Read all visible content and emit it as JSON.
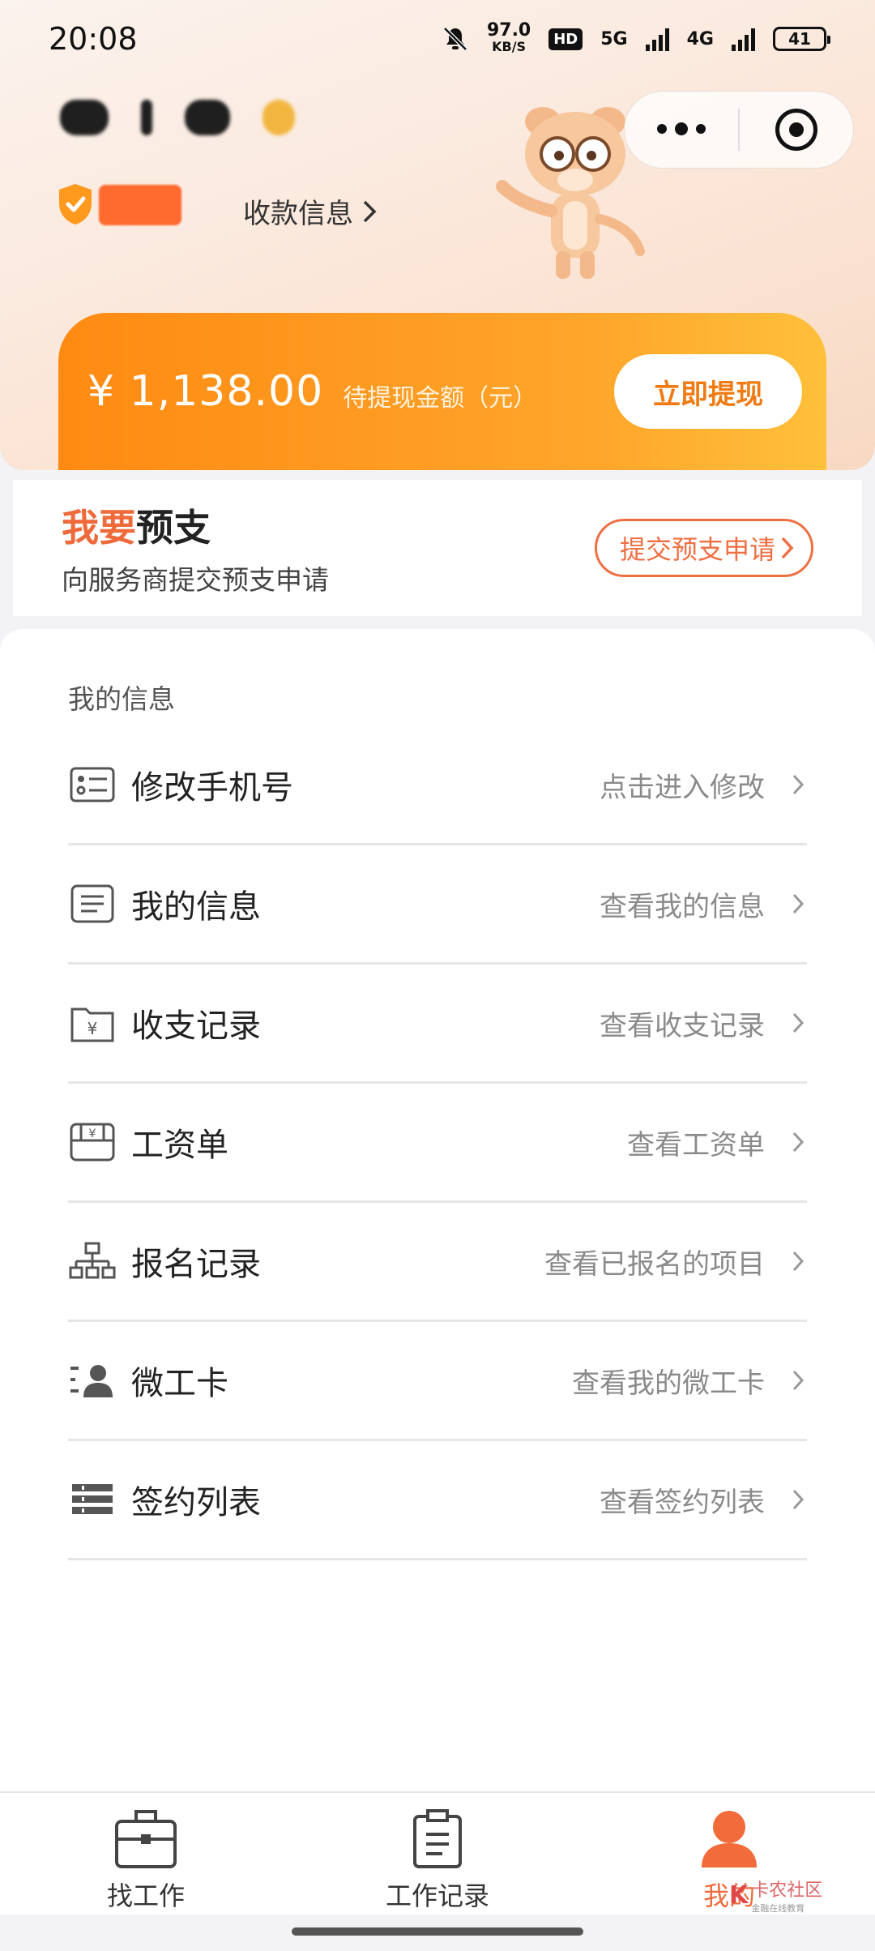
{
  "status_bar": {
    "time": "20:08",
    "net_speed": "97.0",
    "net_unit": "KB/S",
    "hd_label": "HD",
    "net1": "5G",
    "net2": "4G",
    "battery": "41"
  },
  "header": {
    "pay_info_label": "收款信息"
  },
  "balance": {
    "amount": "¥ 1,138.00",
    "label": "待提现金额（元）",
    "withdraw_button": "立即提现"
  },
  "advance": {
    "title_accent": "我要",
    "title_rest": "预支",
    "subtitle": "向服务商提交预支申请",
    "button": "提交预支申请"
  },
  "info": {
    "section_title": "我的信息",
    "items": [
      {
        "label": "修改手机号",
        "hint": "点击进入修改",
        "icon": "id-card-icon"
      },
      {
        "label": "我的信息",
        "hint": "查看我的信息",
        "icon": "document-icon"
      },
      {
        "label": "收支记录",
        "hint": "查看收支记录",
        "icon": "yuan-folder-icon"
      },
      {
        "label": "工资单",
        "hint": "查看工资单",
        "icon": "payslip-icon"
      },
      {
        "label": "报名记录",
        "hint": "查看已报名的项目",
        "icon": "org-chart-icon"
      },
      {
        "label": "微工卡",
        "hint": "查看我的微工卡",
        "icon": "person-card-icon"
      },
      {
        "label": "签约列表",
        "hint": "查看签约列表",
        "icon": "list-icon"
      }
    ]
  },
  "tabs": [
    {
      "label": "找工作",
      "icon": "briefcase-icon",
      "active": false
    },
    {
      "label": "工作记录",
      "icon": "clipboard-icon",
      "active": false
    },
    {
      "label": "我的",
      "icon": "user-icon",
      "active": true
    }
  ],
  "watermark": {
    "text": "卡农社区",
    "sub": "金融在线教育"
  },
  "colors": {
    "accent_orange": "#ff8a12",
    "accent_red": "#ef6b3c",
    "header_bg": "#fbe6d8"
  }
}
